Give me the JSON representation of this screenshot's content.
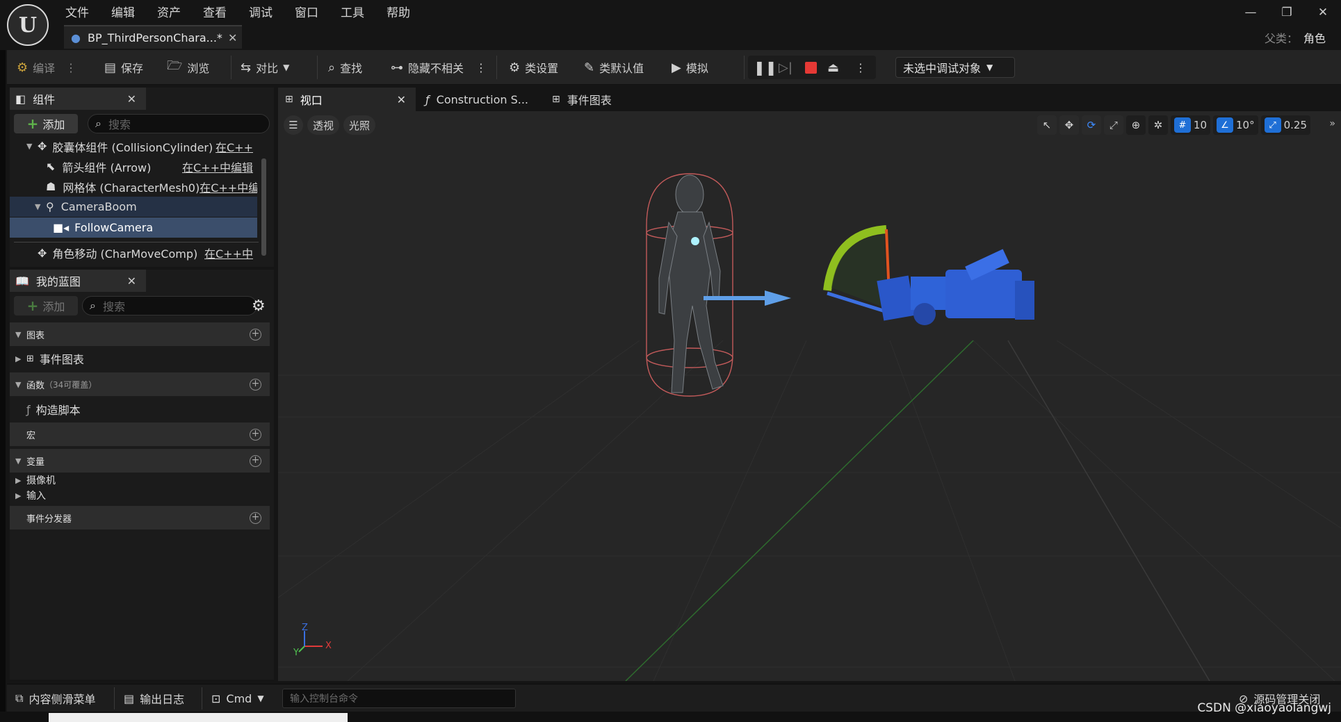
{
  "titlebar": {
    "menu": [
      "文件",
      "编辑",
      "资产",
      "查看",
      "调试",
      "窗口",
      "工具",
      "帮助"
    ],
    "doc_tab": "BP_ThirdPersonChara...*",
    "parent_label": "父类：",
    "parent_value": "角色"
  },
  "toolbar": {
    "compile": "编译",
    "save": "保存",
    "browse": "浏览",
    "diff": "对比",
    "find": "查找",
    "hide_unrelated": "隐藏不相关",
    "class_settings": "类设置",
    "class_defaults": "类默认值",
    "simulate": "模拟",
    "debug_object": "未选中调试对象"
  },
  "components_panel": {
    "title": "组件",
    "add": "添加",
    "search_placeholder": "搜索",
    "items": [
      {
        "label": "胶囊体组件 (CollisionCylinder)",
        "edit": "在C++"
      },
      {
        "label": "箭头组件 (Arrow)",
        "edit": "在C++中编辑"
      },
      {
        "label": "网格体 (CharacterMesh0)",
        "edit": "在C++中编"
      },
      {
        "label": "CameraBoom",
        "edit": ""
      },
      {
        "label": "FollowCamera",
        "edit": ""
      },
      {
        "label": "角色移动 (CharMoveComp)",
        "edit": "在C++中"
      }
    ]
  },
  "blueprint_panel": {
    "title": "我的蓝图",
    "add": "添加",
    "search_placeholder": "搜索",
    "graphs": "图表",
    "event_graph": "事件图表",
    "functions": "函数",
    "functions_note": "（34可覆盖）",
    "construction_script": "构造脚本",
    "macros": "宏",
    "variables": "变量",
    "var_camera": "摄像机",
    "var_input": "输入",
    "event_dispatchers": "事件分发器"
  },
  "viewport_tabs": {
    "viewport": "视口",
    "construction": "Construction S...",
    "event_graph": "事件图表"
  },
  "viewport": {
    "perspective": "透视",
    "lighting": "光照",
    "grid_snap": "10",
    "rotation_snap": "10°",
    "scale_snap": "0.25",
    "axis_x": "X",
    "axis_y": "Y",
    "axis_z": "Z"
  },
  "bottombar": {
    "content_drawer": "内容侧滑菜单",
    "output_log": "输出日志",
    "cmd": "Cmd",
    "console_placeholder": "输入控制台命令",
    "source_control": "源码管理关闭"
  },
  "watermark": "CSDN @xiaoyaolangwj",
  "colors": {
    "accent_blue": "#1f6fd6",
    "stop_red": "#e53935",
    "add_green": "#5fb34b",
    "selection": "#3b4e6b"
  }
}
